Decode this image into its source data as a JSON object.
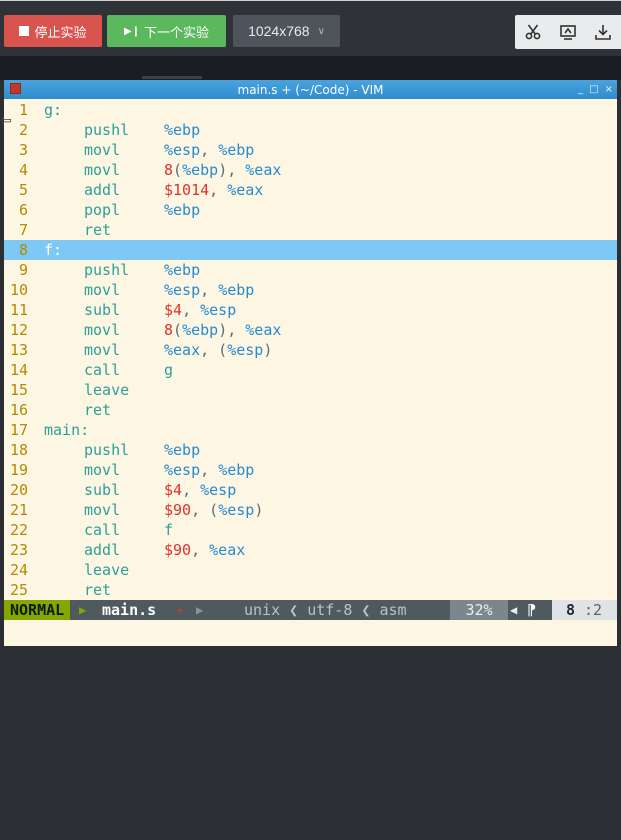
{
  "toolbar": {
    "stop_label": "停止实验",
    "next_label": "下一个实验",
    "resolution": "1024x768",
    "icons": [
      "scissors-icon",
      "screen-share-icon",
      "download-icon"
    ]
  },
  "window": {
    "title": "main.s + (~/Code) - VIM",
    "controls": [
      "_",
      "□",
      "×"
    ]
  },
  "editor": {
    "lines": [
      {
        "n": "1",
        "label": "g:"
      },
      {
        "n": "2",
        "instr": "pushl",
        "ops": [
          [
            "%ebp",
            "reg"
          ]
        ]
      },
      {
        "n": "3",
        "instr": "movl",
        "ops": [
          [
            "%esp",
            "reg"
          ],
          [
            ", ",
            "sym"
          ],
          [
            "%ebp",
            "reg"
          ]
        ]
      },
      {
        "n": "4",
        "instr": "movl",
        "ops": [
          [
            "8",
            "num"
          ],
          [
            "(",
            "sym"
          ],
          [
            "%ebp",
            "reg"
          ],
          [
            "), ",
            "sym"
          ],
          [
            "%eax",
            "reg"
          ]
        ]
      },
      {
        "n": "5",
        "instr": "addl",
        "ops": [
          [
            "$1014",
            "num"
          ],
          [
            ", ",
            "sym"
          ],
          [
            "%eax",
            "reg"
          ]
        ]
      },
      {
        "n": "6",
        "instr": "popl",
        "ops": [
          [
            "%ebp",
            "reg"
          ]
        ]
      },
      {
        "n": "7",
        "instr": "ret",
        "ops": []
      },
      {
        "n": "8",
        "label": "f:",
        "cursor": true
      },
      {
        "n": "9",
        "instr": "pushl",
        "ops": [
          [
            "%ebp",
            "reg"
          ]
        ]
      },
      {
        "n": "10",
        "instr": "movl",
        "ops": [
          [
            "%esp",
            "reg"
          ],
          [
            ", ",
            "sym"
          ],
          [
            "%ebp",
            "reg"
          ]
        ]
      },
      {
        "n": "11",
        "instr": "subl",
        "ops": [
          [
            "$4",
            "num"
          ],
          [
            ", ",
            "sym"
          ],
          [
            "%esp",
            "reg"
          ]
        ]
      },
      {
        "n": "12",
        "instr": "movl",
        "ops": [
          [
            "8",
            "num"
          ],
          [
            "(",
            "sym"
          ],
          [
            "%ebp",
            "reg"
          ],
          [
            "), ",
            "sym"
          ],
          [
            "%eax",
            "reg"
          ]
        ]
      },
      {
        "n": "13",
        "instr": "movl",
        "ops": [
          [
            "%eax",
            "reg"
          ],
          [
            ", (",
            "sym"
          ],
          [
            "%esp",
            "reg"
          ],
          [
            ")",
            "sym"
          ]
        ]
      },
      {
        "n": "14",
        "instr": "call",
        "ops": [
          [
            "g",
            "id"
          ]
        ]
      },
      {
        "n": "15",
        "instr": "leave",
        "ops": []
      },
      {
        "n": "16",
        "instr": "ret",
        "ops": []
      },
      {
        "n": "17",
        "label": "main:"
      },
      {
        "n": "18",
        "instr": "pushl",
        "ops": [
          [
            "%ebp",
            "reg"
          ]
        ]
      },
      {
        "n": "19",
        "instr": "movl",
        "ops": [
          [
            "%esp",
            "reg"
          ],
          [
            ", ",
            "sym"
          ],
          [
            "%ebp",
            "reg"
          ]
        ]
      },
      {
        "n": "20",
        "instr": "subl",
        "ops": [
          [
            "$4",
            "num"
          ],
          [
            ", ",
            "sym"
          ],
          [
            "%esp",
            "reg"
          ]
        ]
      },
      {
        "n": "21",
        "instr": "movl",
        "ops": [
          [
            "$90",
            "num"
          ],
          [
            ", (",
            "sym"
          ],
          [
            "%esp",
            "reg"
          ],
          [
            ")",
            "sym"
          ]
        ]
      },
      {
        "n": "22",
        "instr": "call",
        "ops": [
          [
            "f",
            "id"
          ]
        ]
      },
      {
        "n": "23",
        "instr": "addl",
        "ops": [
          [
            "$90",
            "num"
          ],
          [
            ", ",
            "sym"
          ],
          [
            "%eax",
            "reg"
          ]
        ]
      },
      {
        "n": "24",
        "instr": "leave",
        "ops": []
      },
      {
        "n": "25",
        "instr": "ret",
        "ops": []
      }
    ]
  },
  "statusline": {
    "mode": "NORMAL",
    "filename": "main.s",
    "modified_marker": "+",
    "encoding": "unix ❮ utf-8 ❮ asm",
    "percent": "32%",
    "line_icon": "⁋",
    "line": "8",
    "col": ":2"
  },
  "colors": {
    "stop": "#d9534f",
    "next": "#5cb85c",
    "titlebar": "#3a97d6",
    "editor_bg": "#fdf6e3",
    "cursor_line": "#7ec8f5",
    "mode_bg": "#85a700"
  }
}
